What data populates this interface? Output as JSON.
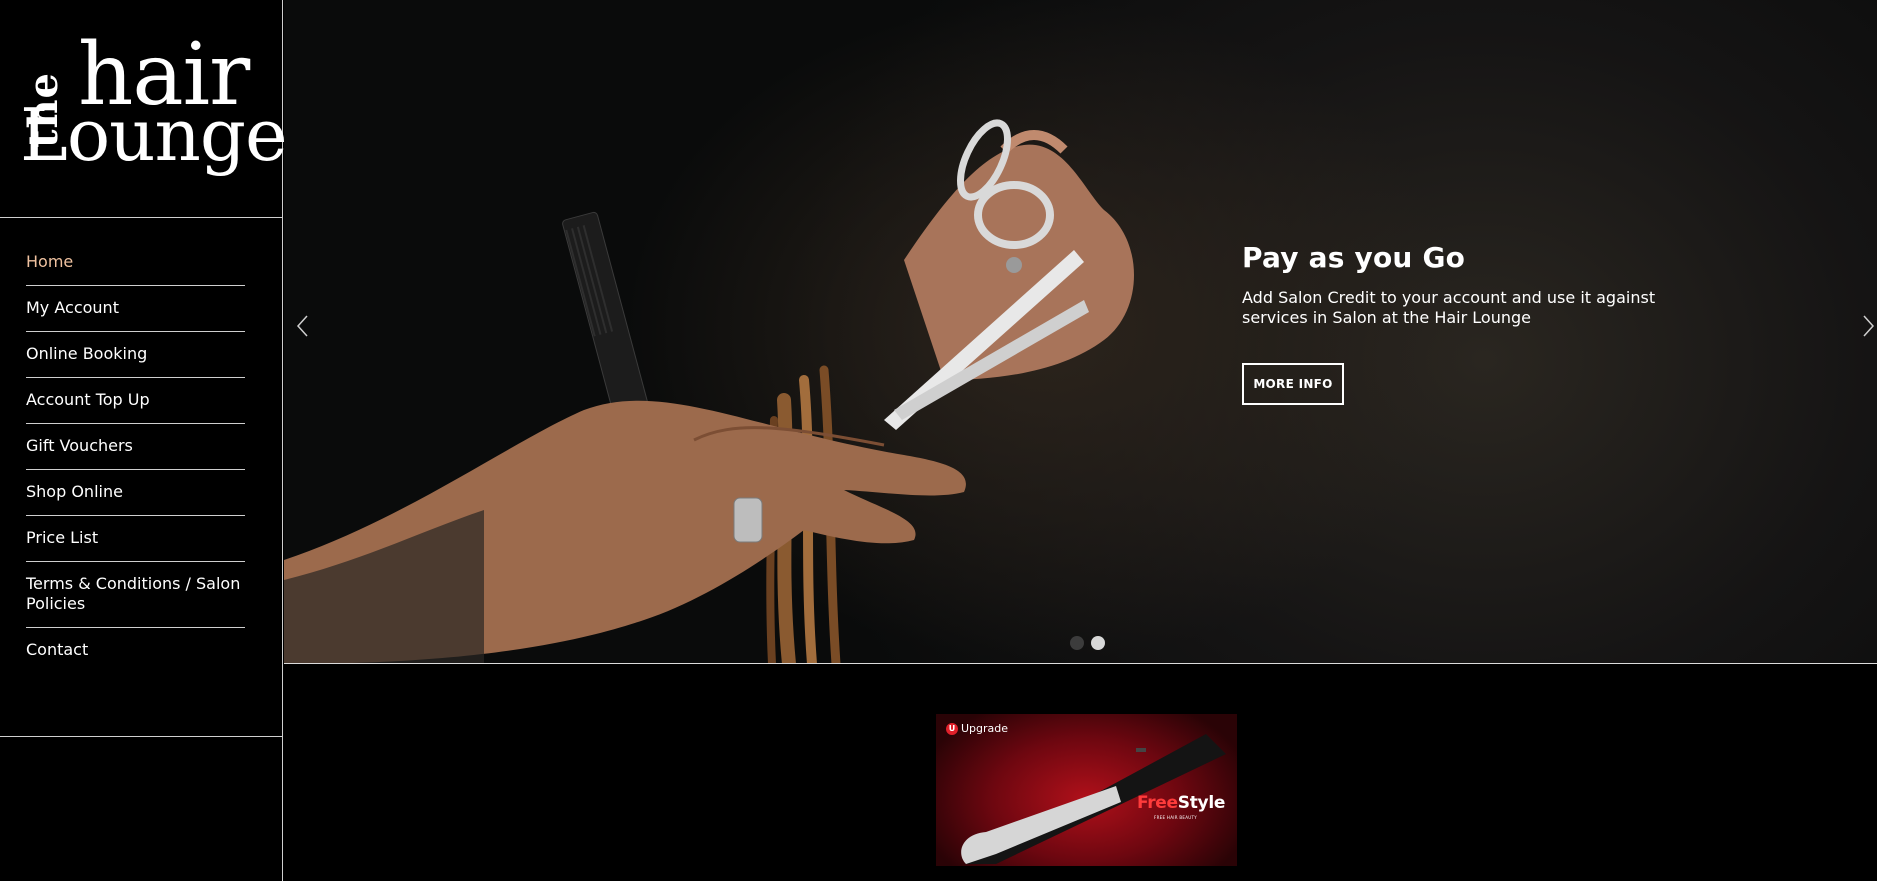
{
  "logo": {
    "the": "the",
    "hair": "hair",
    "lounge": "Lounge"
  },
  "nav": {
    "items": [
      {
        "label": "Home",
        "active": true
      },
      {
        "label": "My Account"
      },
      {
        "label": "Online Booking"
      },
      {
        "label": "Account Top Up"
      },
      {
        "label": "Gift Vouchers"
      },
      {
        "label": "Shop Online"
      },
      {
        "label": "Price List"
      },
      {
        "label": "Terms & Conditions / Salon Policies"
      },
      {
        "label": "Contact"
      }
    ]
  },
  "hero": {
    "title": "Pay as you Go",
    "text": "Add Salon Credit to your account and use it against services in Salon at the Hair Lounge",
    "button": "MORE INFO",
    "prev_icon": "chevron-left-icon",
    "next_icon": "chevron-right-icon",
    "slides": 2,
    "active_slide": 2
  },
  "banner": {
    "brand": "Upgrade",
    "brand_mark": "U",
    "free": "Free",
    "style": "Style",
    "tagline": "FREE HAIR BEAUTY"
  },
  "colors": {
    "active_nav": "#f0c2a0",
    "background": "#000000",
    "accent_red": "#e0202a"
  }
}
